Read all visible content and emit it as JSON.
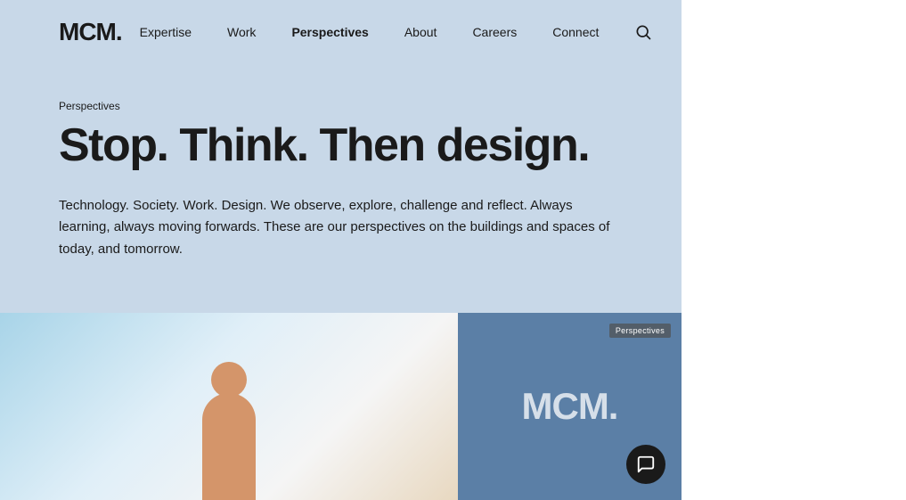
{
  "logo": {
    "text": "MCM."
  },
  "nav": {
    "items": [
      {
        "label": "Expertise",
        "active": false
      },
      {
        "label": "Work",
        "active": false
      },
      {
        "label": "Perspectives",
        "active": true
      },
      {
        "label": "About",
        "active": false
      },
      {
        "label": "Careers",
        "active": false
      },
      {
        "label": "Connect",
        "active": false
      }
    ]
  },
  "hero": {
    "section_label": "Perspectives",
    "title": "Stop. Think. Then design.",
    "body": "Technology. Society. Work. Design. We observe, explore, challenge and reflect. Always learning, always moving forwards. These are our perspectives on the buildings and spaces of today, and tomorrow."
  },
  "card_right": {
    "badge": "Perspectives",
    "logo": "MCM."
  },
  "chat": {
    "label": "Chat"
  }
}
